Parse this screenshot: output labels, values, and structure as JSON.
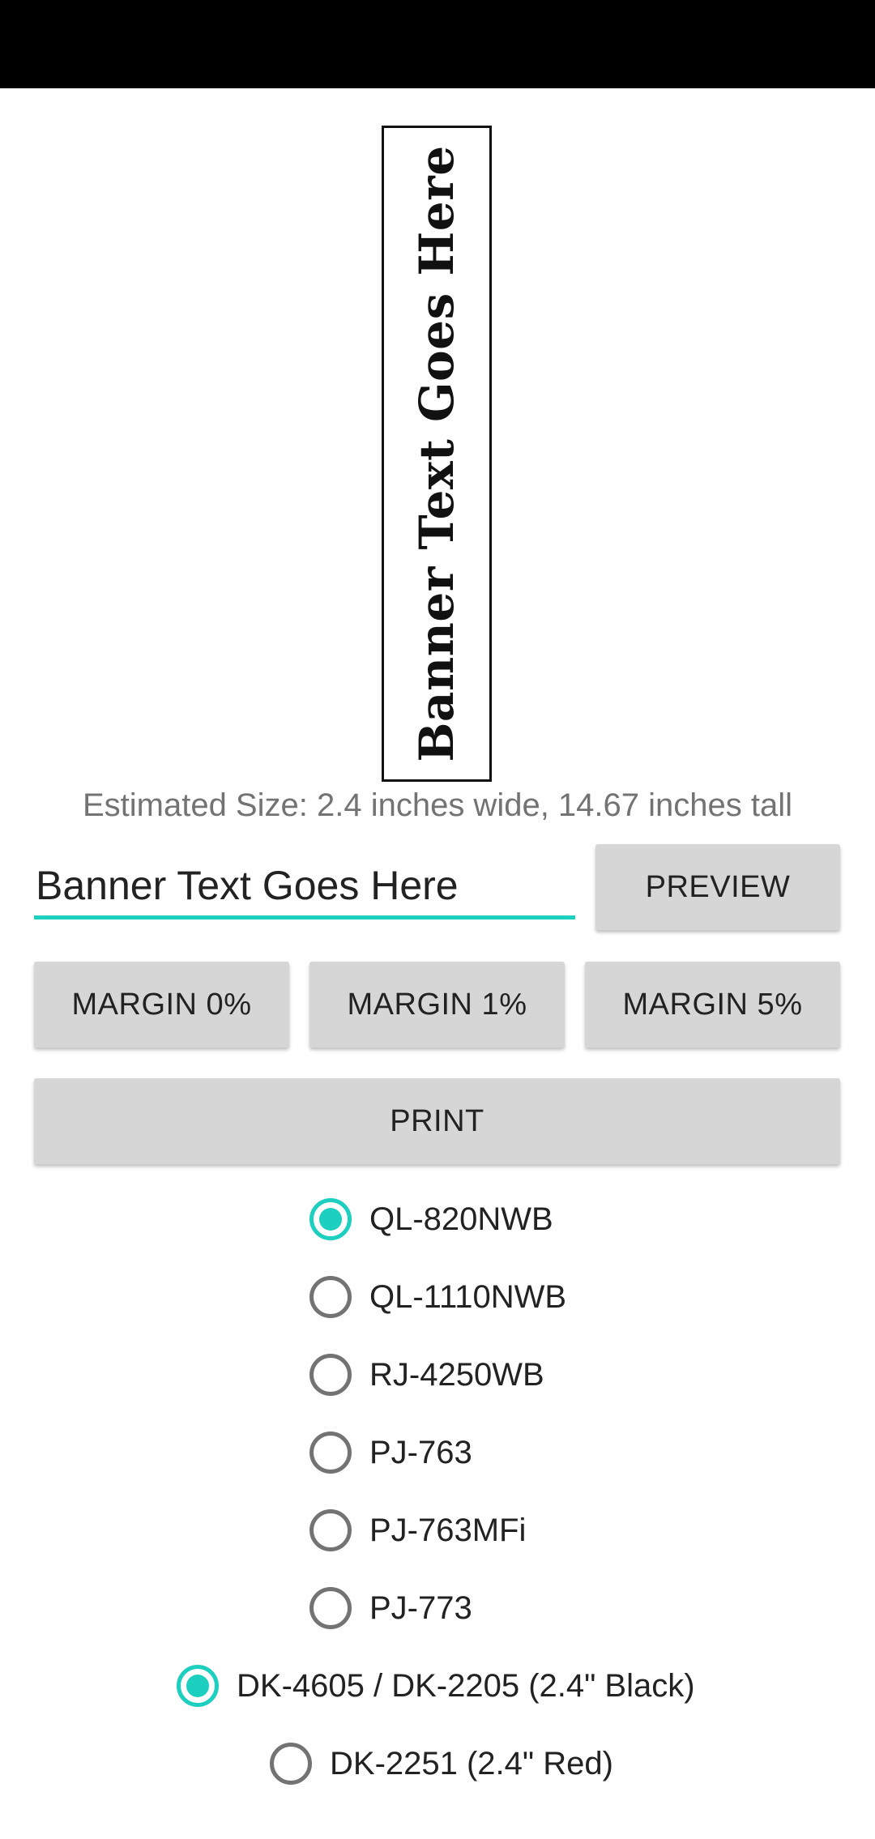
{
  "preview": {
    "banner_text": "Banner Text Goes Here"
  },
  "estimate": {
    "text": "Estimated Size: 2.4 inches wide, 14.67 inches tall"
  },
  "input": {
    "value": "Banner Text Goes Here"
  },
  "buttons": {
    "preview": "PREVIEW",
    "margin_0": "MARGIN 0%",
    "margin_1": "MARGIN 1%",
    "margin_5": "MARGIN 5%",
    "print": "PRINT"
  },
  "printers": [
    {
      "label": "QL-820NWB",
      "selected": true
    },
    {
      "label": "QL-1110NWB",
      "selected": false
    },
    {
      "label": "RJ-4250WB",
      "selected": false
    },
    {
      "label": "PJ-763",
      "selected": false
    },
    {
      "label": "PJ-763MFi",
      "selected": false
    },
    {
      "label": "PJ-773",
      "selected": false
    }
  ],
  "labels": [
    {
      "label": "DK-4605 / DK-2205 (2.4\" Black)",
      "selected": true
    },
    {
      "label": "DK-2251 (2.4\" Red)",
      "selected": false
    }
  ],
  "colors": {
    "accent": "#1ccfbf",
    "button_bg": "#d6d6d6",
    "status_bar": "#000000"
  }
}
